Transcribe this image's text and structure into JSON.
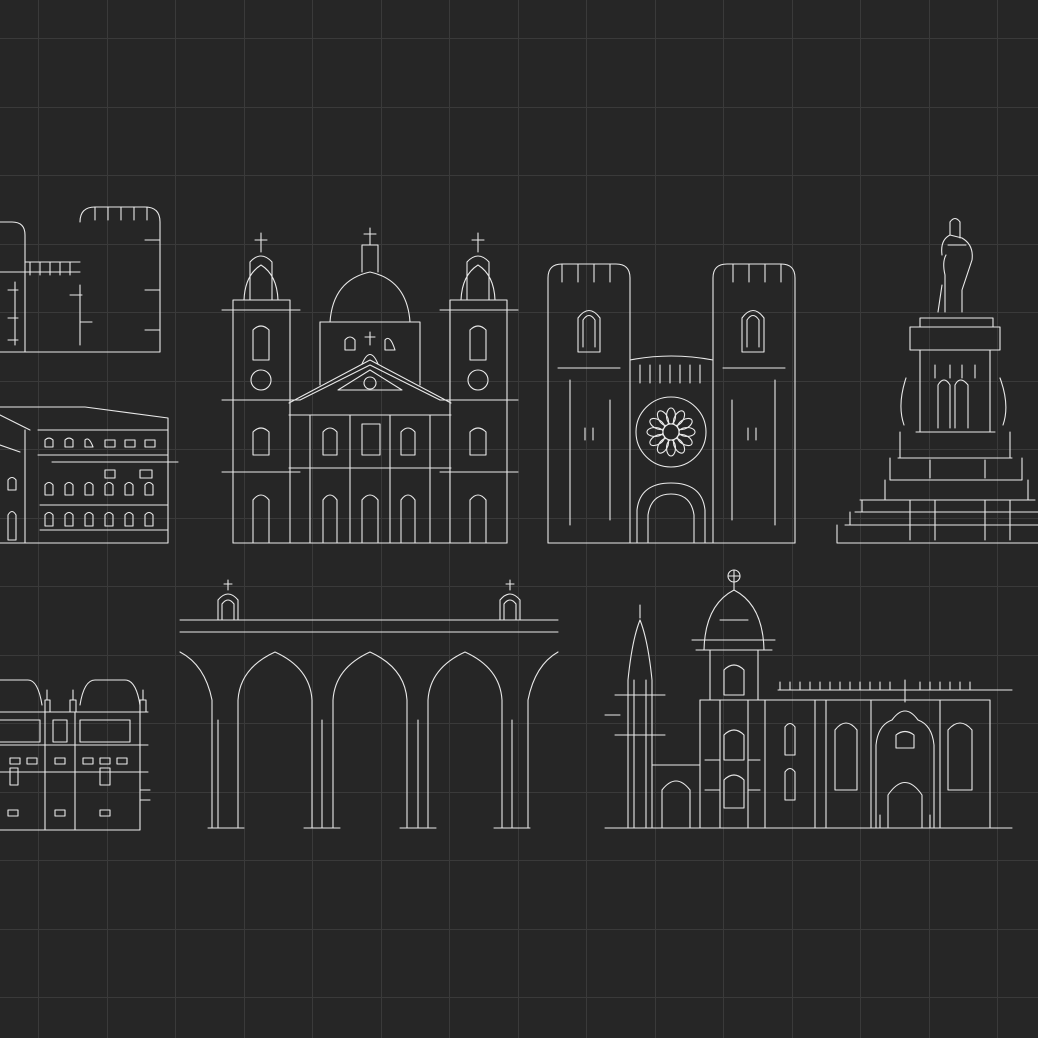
{
  "palette": {
    "background": "#262626",
    "grid": "#3a3a3a",
    "line": "#e9e9e9"
  },
  "illustrations": [
    {
      "name": "twin-tower-building-icon"
    },
    {
      "name": "baroque-church-icon"
    },
    {
      "name": "twin-tower-cathedral-icon"
    },
    {
      "name": "monument-statue-icon"
    },
    {
      "name": "palace-facade-icon"
    },
    {
      "name": "mansard-building-icon"
    },
    {
      "name": "aqueduct-icon"
    },
    {
      "name": "monastery-icon"
    }
  ]
}
